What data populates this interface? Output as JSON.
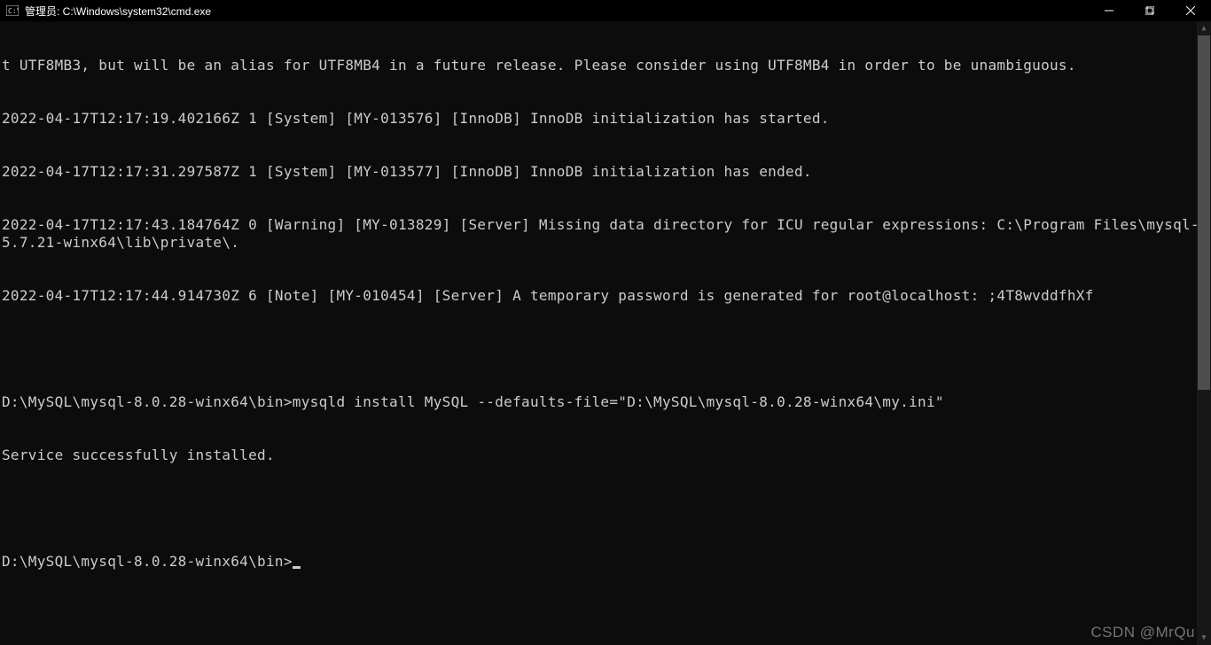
{
  "titlebar": {
    "title": "管理员: C:\\Windows\\system32\\cmd.exe"
  },
  "terminal": {
    "lines": [
      "t UTF8MB3, but will be an alias for UTF8MB4 in a future release. Please consider using UTF8MB4 in order to be unambiguous.",
      "2022-04-17T12:17:19.402166Z 1 [System] [MY-013576] [InnoDB] InnoDB initialization has started.",
      "2022-04-17T12:17:31.297587Z 1 [System] [MY-013577] [InnoDB] InnoDB initialization has ended.",
      "2022-04-17T12:17:43.184764Z 0 [Warning] [MY-013829] [Server] Missing data directory for ICU regular expressions: C:\\Program Files\\mysql-5.7.21-winx64\\lib\\private\\.",
      "2022-04-17T12:17:44.914730Z 6 [Note] [MY-010454] [Server] A temporary password is generated for root@localhost: ;4T8wvddfhXf",
      "",
      "D:\\MySQL\\mysql-8.0.28-winx64\\bin>mysqld install MySQL --defaults-file=\"D:\\MySQL\\mysql-8.0.28-winx64\\my.ini\"",
      "Service successfully installed.",
      "",
      "D:\\MySQL\\mysql-8.0.28-winx64\\bin>"
    ]
  },
  "watermark": "CSDN @MrQu"
}
